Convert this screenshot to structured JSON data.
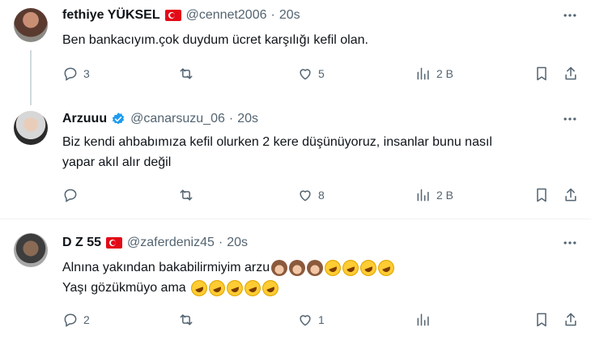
{
  "tweets": [
    {
      "name": "fethiye YÜKSEL",
      "has_flag": true,
      "verified": false,
      "handle": "@cennet2006",
      "dot": "·",
      "time": "20s",
      "lines": [
        "Ben bankacıyım.çok duydum ücret karşılığı kefil olan."
      ],
      "replies": "3",
      "retweets": "",
      "likes": "5",
      "views": "2 B"
    },
    {
      "name": "Arzuuu",
      "has_flag": false,
      "verified": true,
      "handle": "@canarsuzu_06",
      "dot": "·",
      "time": "20s",
      "lines": [
        "Biz kendi ahbabımıza kefil olurken 2 kere düşünüyoruz, insanlar bunu nasıl",
        "yapar akıl alır değil"
      ],
      "replies": "",
      "retweets": "",
      "likes": "8",
      "views": "2 B"
    },
    {
      "name": "D Z 55",
      "has_flag": true,
      "verified": false,
      "handle": "@zaferdeniz45",
      "dot": "·",
      "time": "20s",
      "lines": [
        "Alnına yakından bakabilirmiyim arzu",
        "Yaşı gözükmüyo ama"
      ],
      "replies": "2",
      "retweets": "",
      "likes": "1",
      "views": ""
    }
  ],
  "icons": {
    "reply": "reply-icon",
    "retweet": "retweet-icon",
    "like": "heart-icon",
    "views": "views-icon",
    "bookmark": "bookmark-icon",
    "share": "share-icon",
    "more": "more-icon",
    "verified": "verified-badge-icon",
    "flag": "turkey-flag-icon"
  },
  "colors": {
    "text": "#0f1419",
    "muted": "#536471",
    "verified": "#1d9bf0",
    "divider": "#eff3f4",
    "flag": "#e30a17"
  }
}
